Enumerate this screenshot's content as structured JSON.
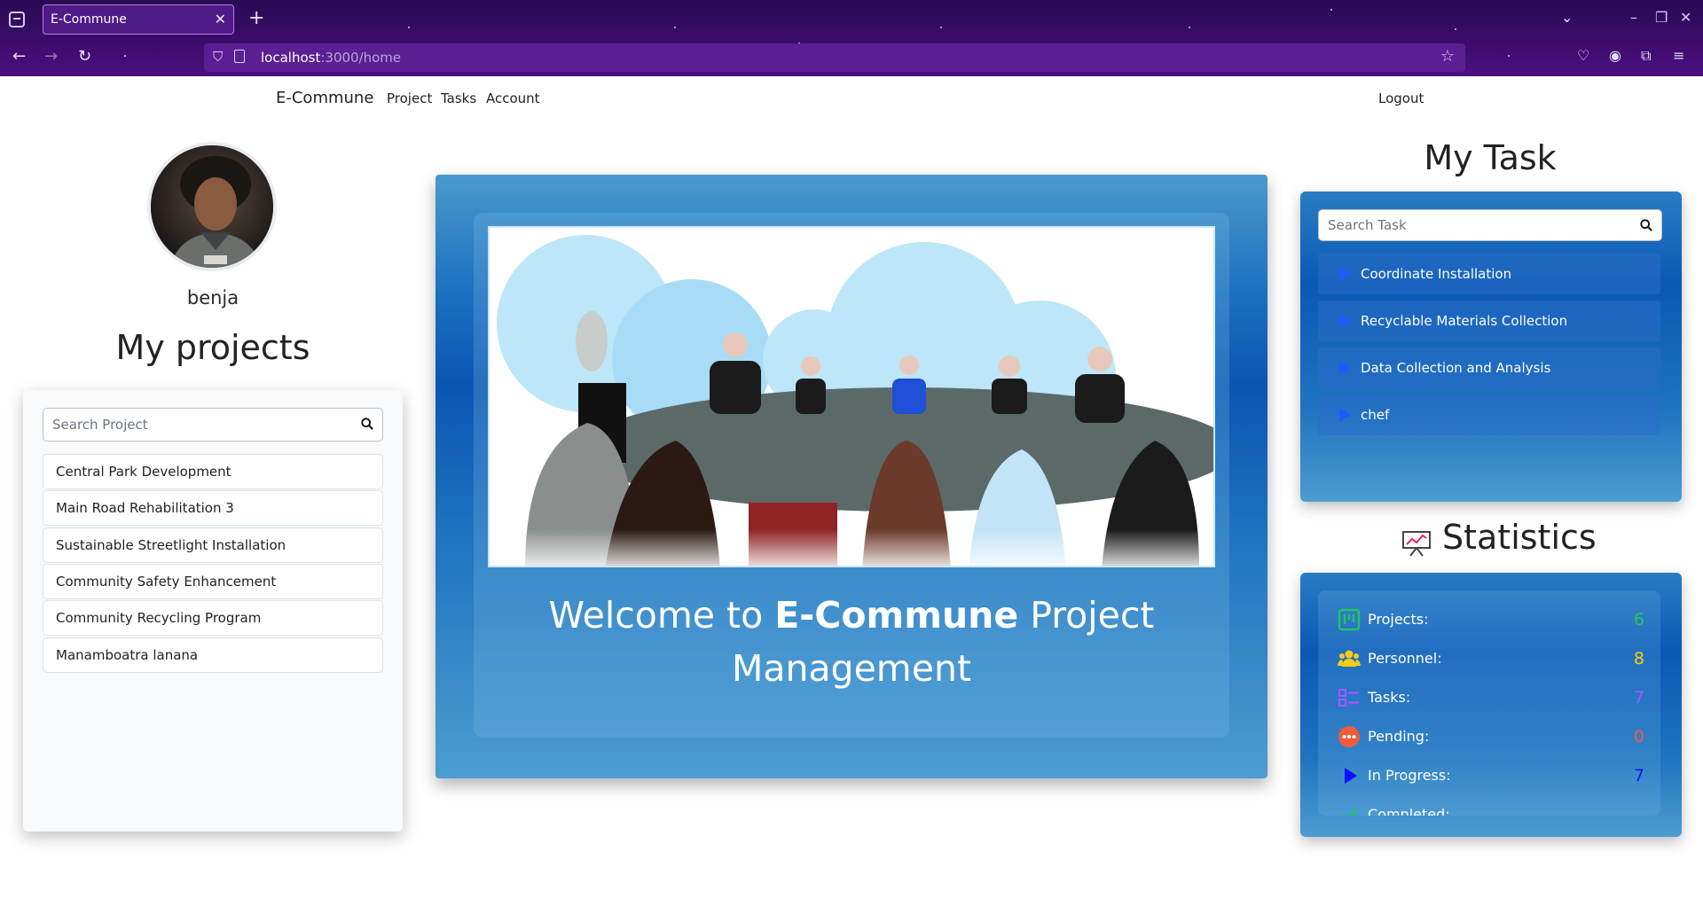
{
  "browser": {
    "tab_title": "E-Commune",
    "tab_close": "✕",
    "new_tab": "+",
    "url_host": "localhost",
    "url_rest": ":3000/home"
  },
  "nav": {
    "brand": "E-Commune",
    "links": [
      "Project",
      "Tasks",
      "Account"
    ],
    "logout": "Logout"
  },
  "profile": {
    "username": "benja"
  },
  "projects": {
    "heading": "My projects",
    "search_placeholder": "Search Project",
    "items": [
      "Central Park Development",
      "Main Road Rehabilitation 3",
      "Sustainable Streetlight Installation",
      "Community Safety Enhancement",
      "Community Recycling Program",
      "Manamboatra lanana"
    ]
  },
  "hero": {
    "welcome_prefix": "Welcome to ",
    "welcome_brand": "E-Commune",
    "welcome_suffix": " Project Management"
  },
  "tasks": {
    "heading": "My Task",
    "search_placeholder": "Search Task",
    "items": [
      "Coordinate Installation",
      "Recyclable Materials Collection",
      "Data Collection and Analysis",
      "chef"
    ]
  },
  "statistics": {
    "heading": "Statistics",
    "rows": [
      {
        "label": "Projects:",
        "value": "6",
        "color": "#22c55e",
        "icon": "kanban-icon"
      },
      {
        "label": "Personnel:",
        "value": "8",
        "color": "#facc15",
        "icon": "users-icon"
      },
      {
        "label": "Tasks:",
        "value": "7",
        "color": "#a855f7",
        "icon": "checklist-icon"
      },
      {
        "label": "Pending:",
        "value": "0",
        "color": "#ef5b3b",
        "icon": "pending-icon"
      },
      {
        "label": "In Progress:",
        "value": "7",
        "color": "#1010ff",
        "icon": "play-icon"
      },
      {
        "label": "Completed:",
        "value": "",
        "color": "#22c55e",
        "icon": "check-icon"
      }
    ]
  }
}
